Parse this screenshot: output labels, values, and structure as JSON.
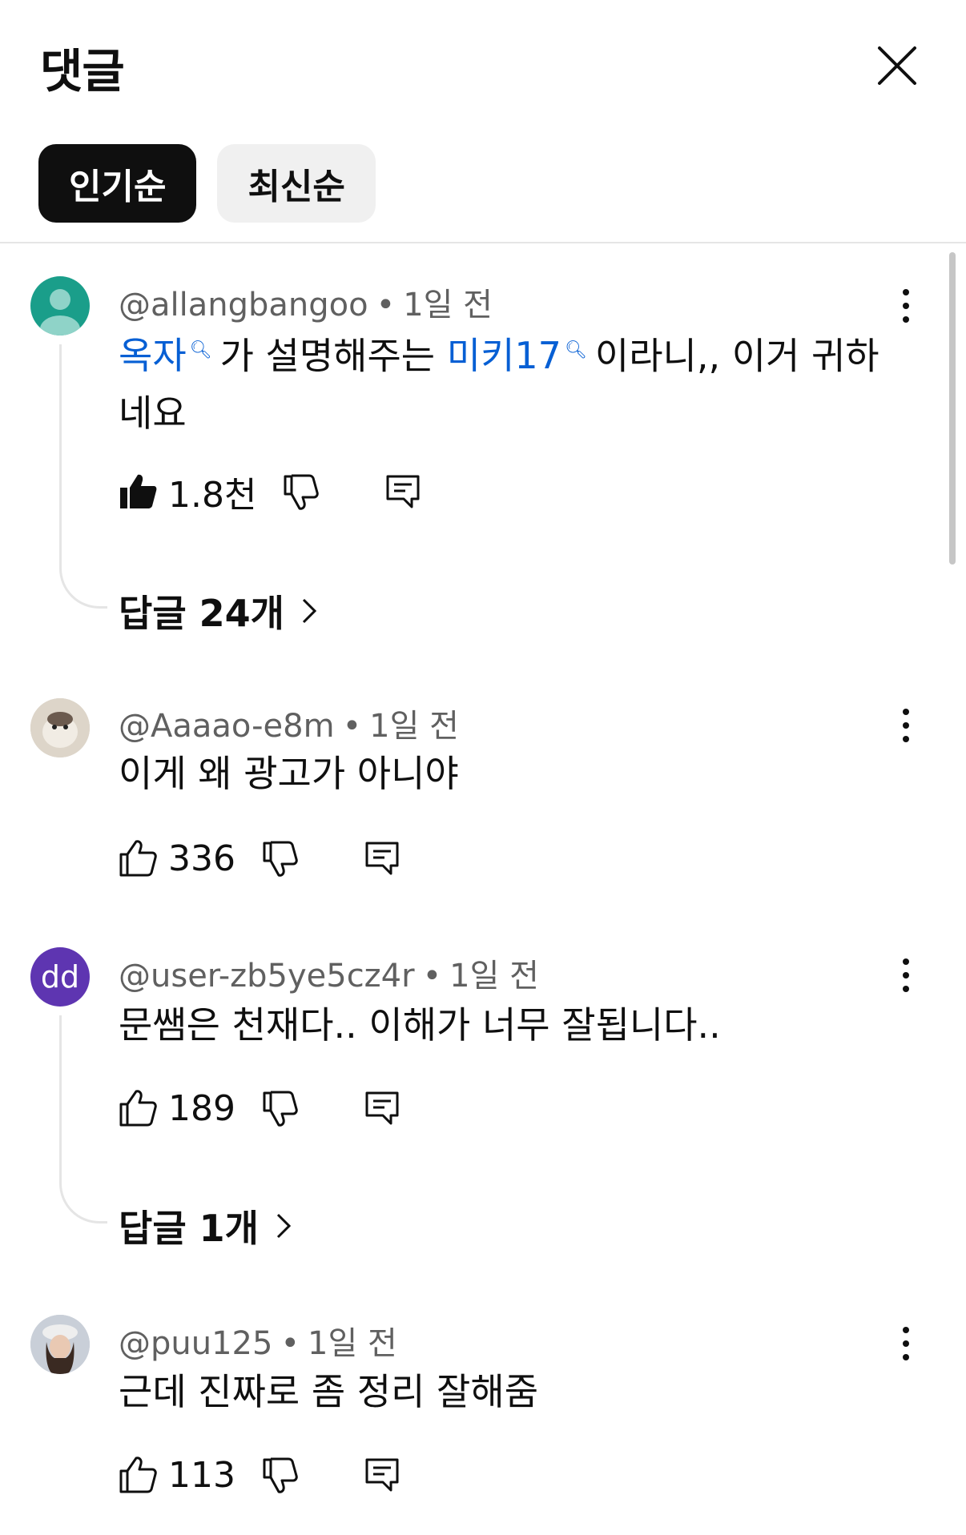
{
  "header": {
    "title": "댓글"
  },
  "sort_chips": [
    {
      "label": "인기순",
      "active": true
    },
    {
      "label": "최신순",
      "active": false
    }
  ],
  "comments": [
    {
      "author": "@allangbangoo",
      "time": "1일 전",
      "link1": "옥자",
      "text_mid": "가 설명해주는 ",
      "link2": "미키17",
      "text_end": "이라니,, 이거 귀하네요",
      "likes": "1.8천",
      "liked": true,
      "replies": "답글 24개",
      "avatar_color": "#1a9e8a"
    },
    {
      "author": "@Aaaao-e8m",
      "time": "1일 전",
      "text": "이게 왜 광고가 아니야",
      "likes": "336",
      "liked": false
    },
    {
      "author": "@user-zb5ye5cz4r",
      "time": "1일 전",
      "text": "문쌤은 천재다.. 이해가 너무 잘됩니다..",
      "likes": "189",
      "liked": false,
      "replies": "답글 1개",
      "avatar_initials": "dd",
      "avatar_color": "#5e35b1"
    },
    {
      "author": "@puu125",
      "time": "1일 전",
      "text": "근데 진짜로 좀 정리 잘해줌",
      "likes": "113",
      "liked": false
    }
  ],
  "colors": {
    "link": "#065fd4",
    "meta": "#606060",
    "chip_active": "#0f0f0f",
    "chip_inactive": "#f0f0f0"
  }
}
